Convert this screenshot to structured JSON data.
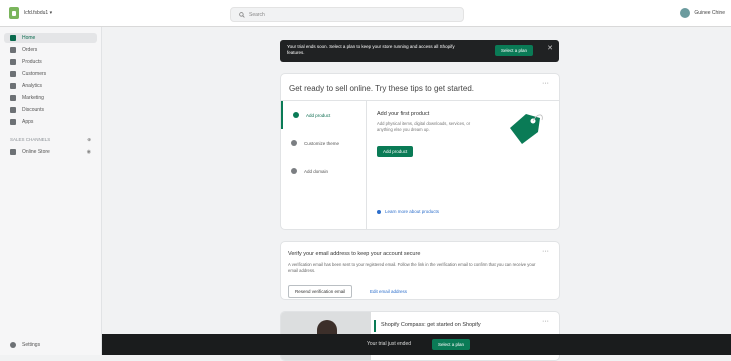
{
  "topbar": {
    "store_name": "lcfd.fsbdu1 ▾",
    "search_placeholder": "Search",
    "user_name": "Guinee Chine"
  },
  "sidebar": {
    "items": [
      {
        "label": "Home",
        "icon": "home-icon"
      },
      {
        "label": "Orders",
        "icon": "orders-icon"
      },
      {
        "label": "Products",
        "icon": "tag-icon"
      },
      {
        "label": "Customers",
        "icon": "person-icon"
      },
      {
        "label": "Analytics",
        "icon": "bar-chart-icon"
      },
      {
        "label": "Marketing",
        "icon": "megaphone-icon"
      },
      {
        "label": "Discounts",
        "icon": "discount-icon"
      },
      {
        "label": "Apps",
        "icon": "apps-icon"
      }
    ],
    "channels_label": "SALES CHANNELS",
    "online_store": "Online Store",
    "settings": "Settings"
  },
  "banner": {
    "text": "Your trial ends soon. Select a plan to keep your store running and access all Shopify features.",
    "button": "Select a plan",
    "close": "✕"
  },
  "setup": {
    "title": "Get ready to sell online. Try these tips to get started.",
    "more": "···",
    "tabs": [
      {
        "label": "Add product"
      },
      {
        "label": "Customize theme"
      },
      {
        "label": "Add domain"
      }
    ],
    "panel_title": "Add your first product",
    "panel_desc": "Add physical items, digital downloads, services, or anything else you dream up.",
    "panel_button": "Add product",
    "learn_more": "Learn more about products"
  },
  "verify": {
    "title": "Verify your email address to keep your account secure",
    "desc": "A verification email has been sent to your registered email. Follow the link in the verification email to confirm that you can receive your email address.",
    "resend": "Resend verification email",
    "link": "Edit email address",
    "more": "···"
  },
  "compass": {
    "title": "Shopify Compass: get started on Shopify",
    "more": "···"
  },
  "footer": {
    "text": "Your trial just ended",
    "button": "Select a plan"
  },
  "colors": {
    "accent": "#0a7b56",
    "dark": "#202223"
  }
}
